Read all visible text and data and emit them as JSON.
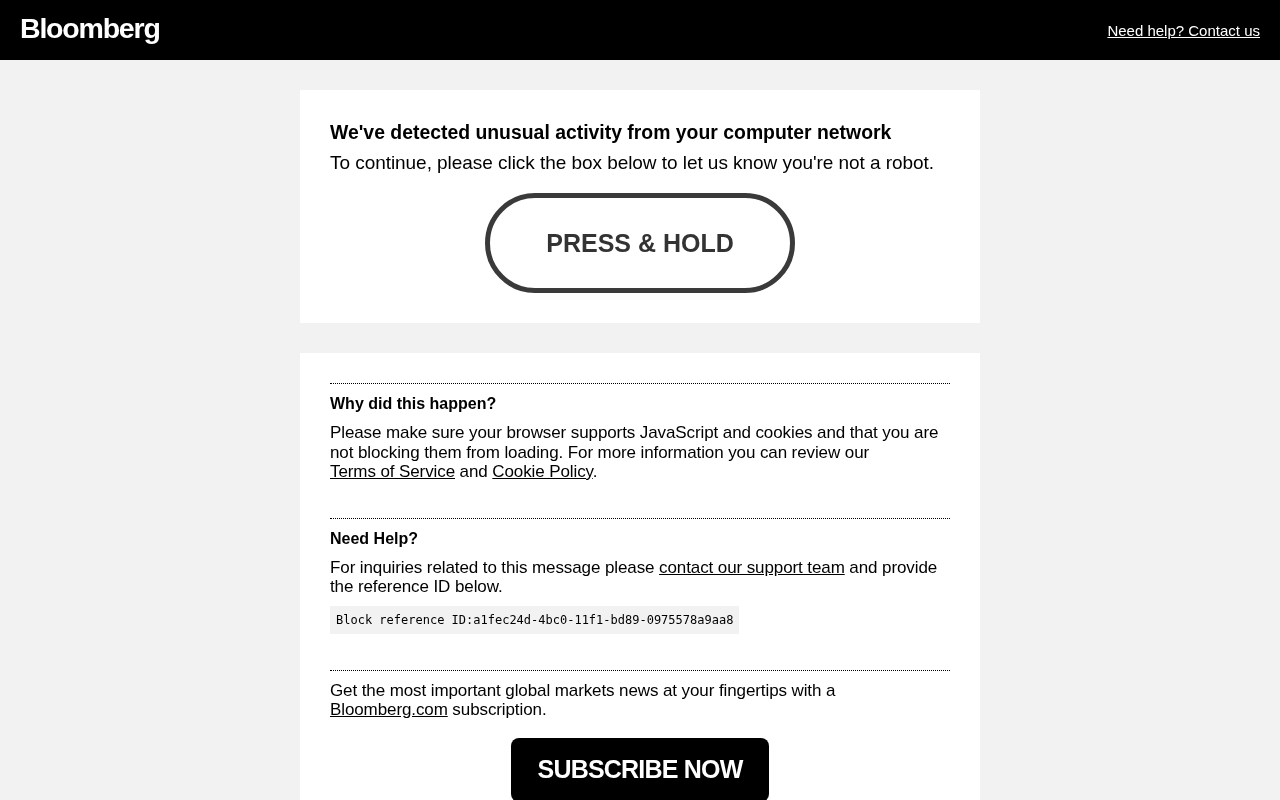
{
  "header": {
    "logo": "Bloomberg",
    "help_link": "Need help? Contact us"
  },
  "challenge": {
    "title": "We've detected unusual activity from your computer network",
    "instruction": "To continue, please click the box below to let us know you're not a robot.",
    "button": "PRESS & HOLD"
  },
  "info_sections": [
    {
      "heading": "Why did this happen?",
      "paragraph": [
        {
          "kind": "text",
          "text": "Please make sure your browser supports JavaScript and cookies and that you are not blocking them from loading. For more information you can review our "
        },
        {
          "kind": "link",
          "text": "Terms of Service"
        },
        {
          "kind": "text",
          "text": " and "
        },
        {
          "kind": "link",
          "text": "Cookie Policy"
        },
        {
          "kind": "text",
          "text": "."
        }
      ]
    },
    {
      "heading": "Need Help?",
      "paragraph": [
        {
          "kind": "text",
          "text": "For inquiries related to this message please "
        },
        {
          "kind": "link",
          "text": "contact our support team"
        },
        {
          "kind": "text",
          "text": " and provide the reference ID below."
        }
      ],
      "reference": "Block reference ID:a1fec24d-4bc0-11f1-bd89-0975578a9aa8"
    },
    {
      "paragraph": [
        {
          "kind": "text",
          "text": "Get the most important global markets news at your fingertips with a "
        },
        {
          "kind": "link",
          "text": "Bloomberg.com"
        },
        {
          "kind": "text",
          "text": " subscription."
        }
      ],
      "button": "SUBSCRIBE NOW"
    }
  ]
}
